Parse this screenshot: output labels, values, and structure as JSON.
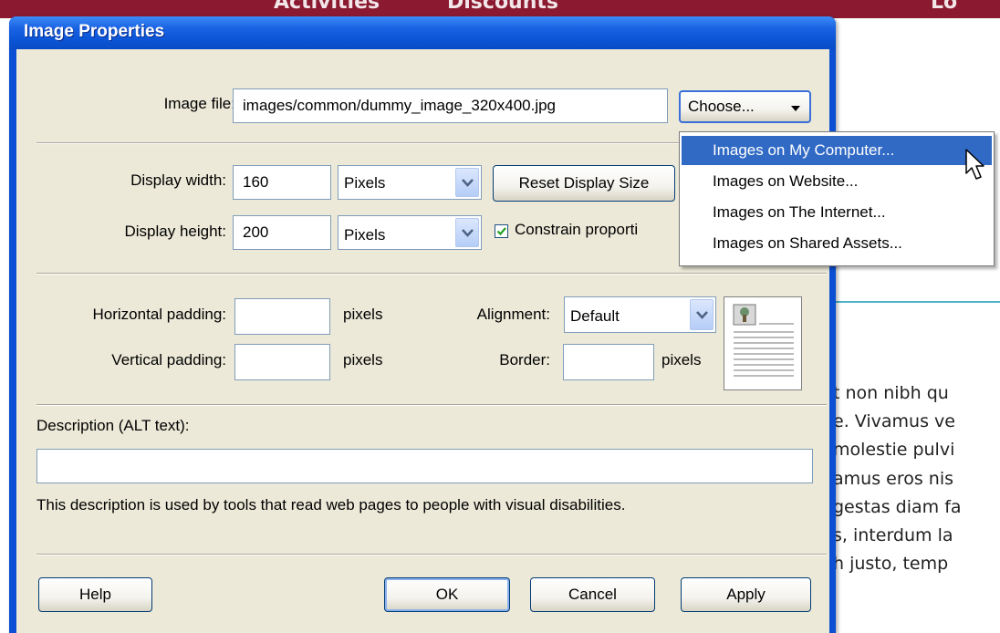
{
  "background": {
    "banner_left_text": "Activities",
    "banner_mid_text": "Discounts",
    "banner_right_text": "Lo",
    "body_lines": [
      "t non nibh qu",
      "e. Vivamus ve",
      "molestie pulvi",
      "amus eros nis",
      "gestas diam fa",
      "s, interdum la",
      "h justo, temp"
    ]
  },
  "dialog": {
    "title": "Image Properties",
    "image_file": {
      "label": "Image file:",
      "value": "images/common/dummy_image_320x400.jpg",
      "choose_label": "Choose..."
    },
    "choose_menu": [
      "Images on My Computer...",
      "Images on Website...",
      "Images on The Internet...",
      "Images on Shared Assets..."
    ],
    "display_width": {
      "label": "Display width:",
      "value": "160",
      "unit": "Pixels"
    },
    "display_height": {
      "label": "Display height:",
      "value": "200",
      "unit": "Pixels"
    },
    "reset_label": "Reset Display Size",
    "constrain": {
      "label": "Constrain proporti",
      "checked": true
    },
    "h_padding": {
      "label": "Horizontal padding:",
      "value": "",
      "unit": "pixels"
    },
    "v_padding": {
      "label": "Vertical padding:",
      "value": "",
      "unit": "pixels"
    },
    "alignment": {
      "label": "Alignment:",
      "value": "Default"
    },
    "border": {
      "label": "Border:",
      "value": "",
      "unit": "pixels"
    },
    "description": {
      "label": "Description (ALT text):",
      "value": "",
      "help": "This description is used by tools that read web pages to people with visual disabilities."
    },
    "buttons": {
      "help": "Help",
      "ok": "OK",
      "cancel": "Cancel",
      "apply": "Apply"
    }
  },
  "colors": {
    "titlebar": "#0a55d6",
    "dialog_bg": "#ece9d8",
    "menu_highlight": "#316ac5",
    "banner": "#8b1a30"
  }
}
